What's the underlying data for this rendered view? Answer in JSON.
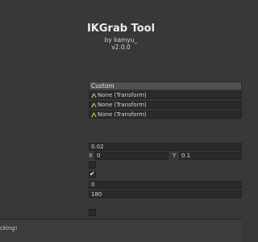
{
  "header": {
    "title": "IKGrab Tool",
    "author": "by kamyu_",
    "version": "v2.0.0"
  },
  "mode_dropdown": {
    "selected": "Custom"
  },
  "object_fields": [
    {
      "value": "None (Transform)",
      "icon": "transform-icon"
    },
    {
      "value": "None (Transform)",
      "icon": "transform-icon"
    },
    {
      "value": "None (Transform)",
      "icon": "transform-icon"
    }
  ],
  "settings": {
    "value_field": "0.02",
    "x_label": "X",
    "x_value": "0",
    "y_label": "Y",
    "y_value": "0.1",
    "toggle_1_checked": false,
    "toggle_2_checked": true,
    "field_a": "0",
    "field_b": "180",
    "toggle_3_checked": false
  },
  "status": {
    "text": "cking!"
  },
  "colors": {
    "background": "#383838",
    "field": "#2a2a2a",
    "dropdown": "#515151",
    "icon_yellow": "#e8c24a",
    "icon_green": "#7fc45f"
  }
}
